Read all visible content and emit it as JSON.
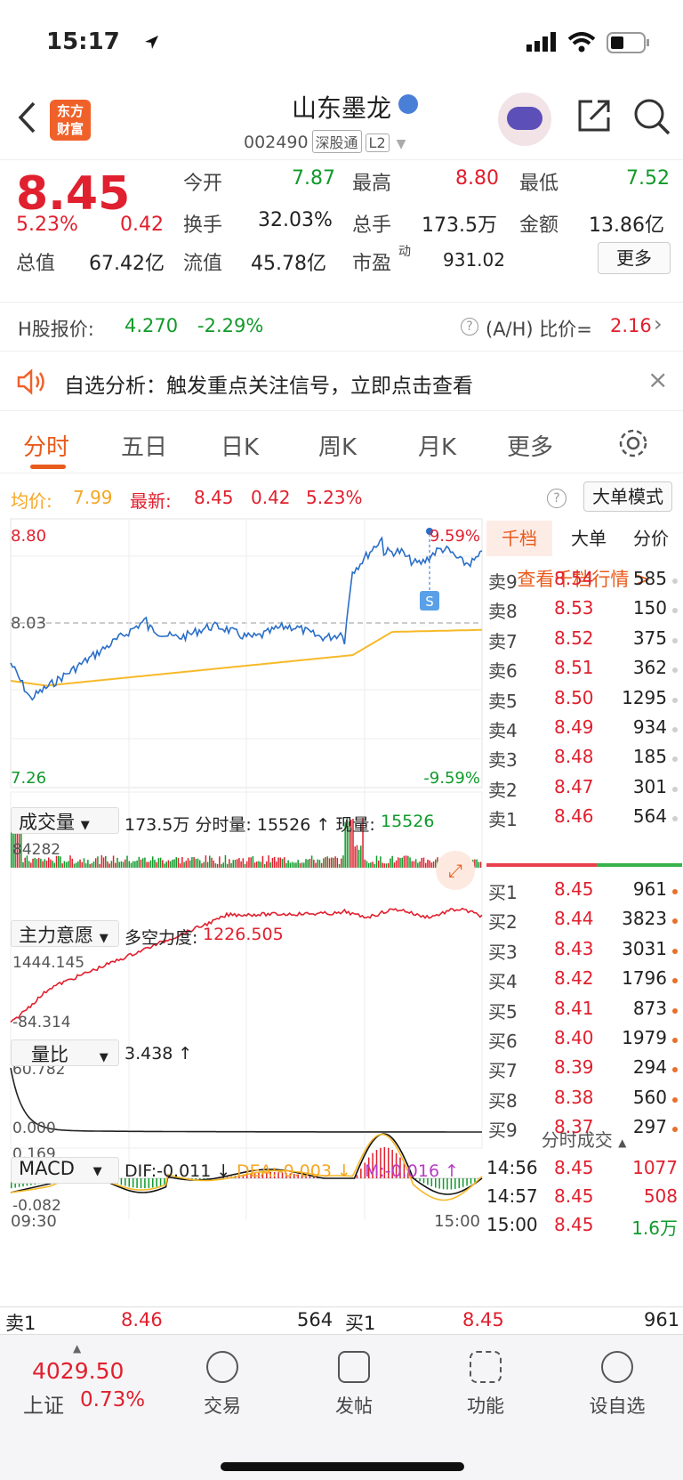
{
  "status": {
    "time": "15:17"
  },
  "nav": {
    "logo_l1": "东方",
    "logo_l2": "财富",
    "title": "山东墨龙",
    "code": "002490",
    "tag1": "深股通",
    "tag2": "L2"
  },
  "quote": {
    "price": "8.45",
    "pct": "5.23%",
    "chg": "0.42",
    "open_l": "今开",
    "open_v": "7.87",
    "high_l": "最高",
    "high_v": "8.80",
    "low_l": "最低",
    "low_v": "7.52",
    "turn_l": "换手",
    "turn_v": "32.03%",
    "vol_l": "总手",
    "vol_v": "173.5万",
    "amt_l": "金额",
    "amt_v": "13.86亿",
    "mc_l": "总值",
    "mc_v": "67.42亿",
    "fc_l": "流值",
    "fc_v": "45.78亿",
    "pe_l": "市盈",
    "pe_sup": "动",
    "pe_v": "931.02",
    "more": "更多"
  },
  "hshare": {
    "label": "H股报价:",
    "price": "4.270",
    "pct": "-2.29%",
    "ratio_l": "(A/H) 比价=",
    "ratio_v": "2.16"
  },
  "alert": {
    "text": "自选分析：触发重点关注信号，立即点击查看"
  },
  "tabs": [
    "分时",
    "五日",
    "日K",
    "周K",
    "月K",
    "更多"
  ],
  "info": {
    "avg_l": "均价:",
    "avg_v": "7.99",
    "new_l": "最新:",
    "new_v": "8.45",
    "chg": "0.42",
    "pct": "5.23%",
    "mode": "大单模式"
  },
  "chart_data": {
    "type": "line",
    "price_high": "8.80",
    "price_mid": "8.03",
    "price_low": "7.26",
    "pct_high": "9.59%",
    "pct_low": "-9.59%",
    "vol_box": "成交量",
    "vol_text": "173.5万 分时量: 15526 ↑ 现量:",
    "vol_now": "15526",
    "vol_max": "84282",
    "mf_box": "主力意愿",
    "mf_text": "多空力度:",
    "mf_v": "1226.505",
    "mf_max": "1444.145",
    "mf_min": "-84.314",
    "lb_box": "量比",
    "lb_v": "3.438 ↑",
    "lb_max": "60.782",
    "lb_min": "0.000",
    "macd_box": "MACD",
    "dif": "DIF:-0.011 ↓",
    "dea": "DEA:-0.003 ↓",
    "m": "M:-0.016 ↑",
    "macd_max": "0.169",
    "macd_min": "-0.082",
    "t_start": "09:30",
    "t_end": "15:00",
    "s_marker": "S"
  },
  "book": {
    "tab1": "千档",
    "tab2": "大单",
    "tab3": "分价",
    "link": "查看千档行情 >",
    "asks": [
      [
        "卖9",
        "8.54",
        "585"
      ],
      [
        "卖8",
        "8.53",
        "150"
      ],
      [
        "卖7",
        "8.52",
        "375"
      ],
      [
        "卖6",
        "8.51",
        "362"
      ],
      [
        "卖5",
        "8.50",
        "1295"
      ],
      [
        "卖4",
        "8.49",
        "934"
      ],
      [
        "卖3",
        "8.48",
        "185"
      ],
      [
        "卖2",
        "8.47",
        "301"
      ],
      [
        "卖1",
        "8.46",
        "564"
      ]
    ],
    "bids": [
      [
        "买1",
        "8.45",
        "961"
      ],
      [
        "买2",
        "8.44",
        "3823"
      ],
      [
        "买3",
        "8.43",
        "3031"
      ],
      [
        "买4",
        "8.42",
        "1796"
      ],
      [
        "买5",
        "8.41",
        "873"
      ],
      [
        "买6",
        "8.40",
        "1979"
      ],
      [
        "买7",
        "8.39",
        "294"
      ],
      [
        "买8",
        "8.38",
        "560"
      ],
      [
        "买9",
        "8.37",
        "297"
      ]
    ],
    "trades_title": "分时成交",
    "trades": [
      [
        "14:56",
        "8.45",
        "1077"
      ],
      [
        "14:57",
        "8.45",
        "508"
      ],
      [
        "15:00",
        "8.45",
        "1.6万"
      ]
    ]
  },
  "bottom": {
    "s1": "卖1",
    "s1p": "8.46",
    "s1v": "564",
    "b1": "买1",
    "b1p": "8.45",
    "b1v": "961"
  },
  "footer": {
    "idx": "4029.50",
    "idx_name": "上证",
    "idx_pct": "0.73%",
    "f1": "交易",
    "f2": "发帖",
    "f3": "功能",
    "f4": "设自选"
  }
}
